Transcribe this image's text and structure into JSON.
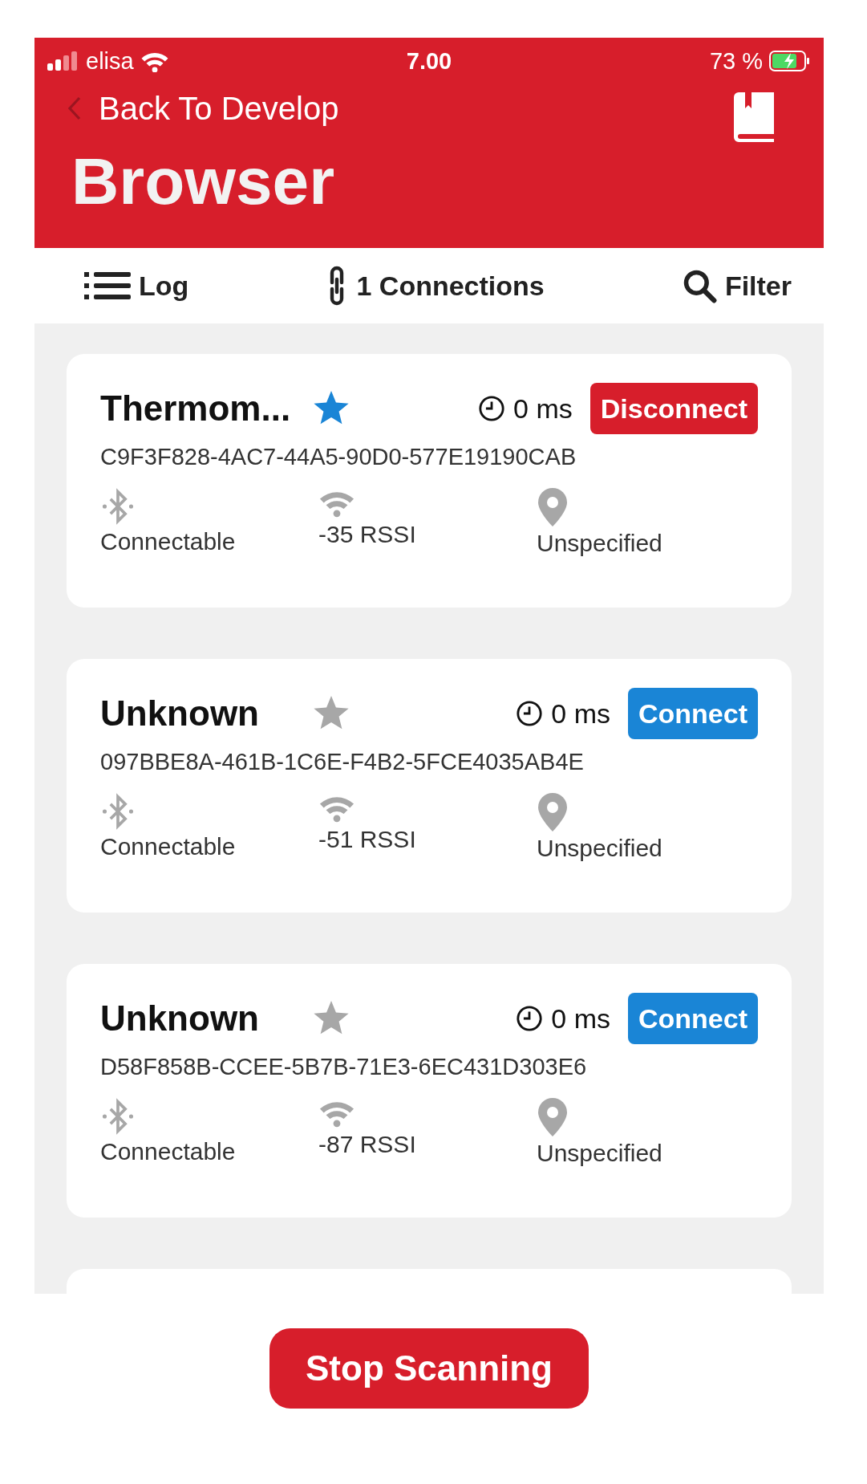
{
  "status_bar": {
    "carrier": "elisa",
    "time": "7.00",
    "battery": "73 %"
  },
  "nav": {
    "back": "Back To Develop",
    "title": "Browser"
  },
  "toolbar": [
    {
      "kind": "log",
      "label": "Log"
    },
    {
      "kind": "connections",
      "label": "1 Connections"
    },
    {
      "kind": "filter",
      "label": "Filter"
    }
  ],
  "devices": [
    {
      "name": "Thermom...",
      "favorite": true,
      "time": "0 ms",
      "connected": true,
      "action": "Disconnect",
      "uuid": "C9F3F828-4AC7-44A5-90D0-577E19190CAB",
      "connectable": "Connectable",
      "rssi": "-35 RSSI",
      "location": "Unspecified"
    },
    {
      "name": "Unknown",
      "favorite": false,
      "time": "0 ms",
      "connected": false,
      "action": "Connect",
      "uuid": "097BBE8A-461B-1C6E-F4B2-5FCE4035AB4E",
      "connectable": "Connectable",
      "rssi": "-51 RSSI",
      "location": "Unspecified"
    },
    {
      "name": "Unknown",
      "favorite": false,
      "time": "0 ms",
      "connected": false,
      "action": "Connect",
      "uuid": "D58F858B-CCEE-5B7B-71E3-6EC431D303E6",
      "connectable": "Connectable",
      "rssi": "-87 RSSI",
      "location": "Unspecified"
    }
  ],
  "scan_button": "Stop Scanning"
}
